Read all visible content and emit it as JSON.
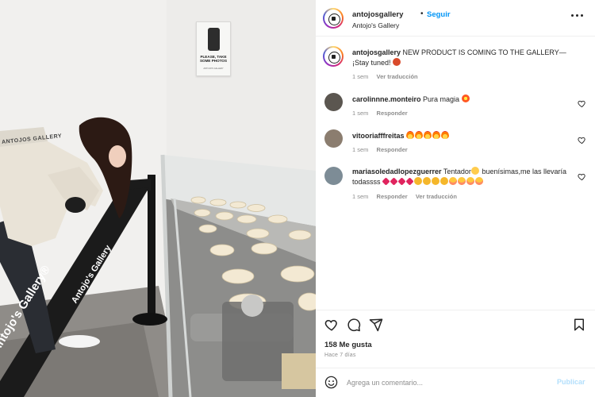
{
  "photo": {
    "sign_text": "PLEASE, TAKE SOME PHOTOS",
    "sign_small": "ANTOJO'S GALLERY",
    "barrier_text": "Antojo's Gallery®",
    "barrier_text_2": "Antojo's Gallery",
    "bag_text": "ANTOJOS GALLERY"
  },
  "header": {
    "username": "antojosgallery",
    "dot": "•",
    "follow_label": "Seguir",
    "location": "Antojo's Gallery",
    "more_icon": "more-horizontal-icon"
  },
  "caption": {
    "username": "antojosgallery",
    "text": "NEW PRODUCT IS COMING TO THE GALLERY—¡Stay tuned!",
    "time": "1 sem",
    "see_translation": "Ver traducción"
  },
  "comments": [
    {
      "username": "carolinnne.monteiro",
      "text": "Pura magia",
      "time": "1 sem",
      "reply": "Responder"
    },
    {
      "username": "vitooriafffreitas",
      "text": "",
      "time": "1 sem",
      "reply": "Responder"
    },
    {
      "username": "mariasoledadlopezguerrer",
      "text": "Tentador",
      "text2": "buenísimas,me las llevaría todassss",
      "time": "1 sem",
      "reply": "Responder",
      "see_translation": "Ver traducción"
    }
  ],
  "actions": {
    "likes": "158 Me gusta",
    "ago": "Hace 7 días"
  },
  "add_comment": {
    "placeholder": "Agrega un comentario...",
    "post_label": "Publicar"
  },
  "colors": {
    "follow": "#0095f6",
    "post_disabled": "#b2dffc",
    "muted": "#8e8e8e",
    "text": "#262626"
  }
}
